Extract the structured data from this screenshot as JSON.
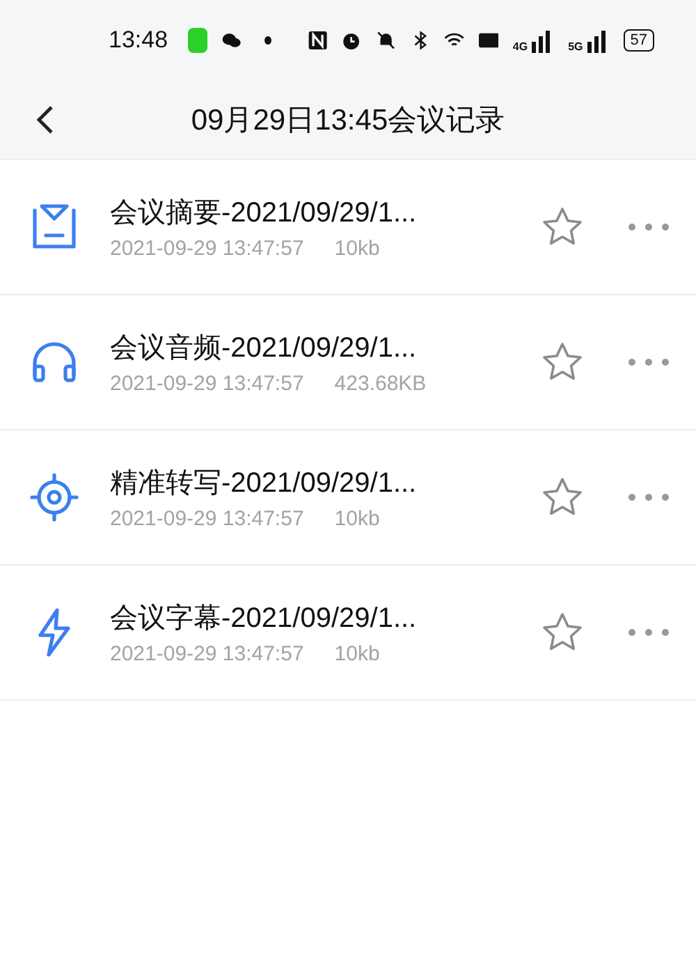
{
  "status_bar": {
    "time": "13:48",
    "network_labels": [
      "4G",
      "5G"
    ],
    "battery": "57"
  },
  "header": {
    "title": "09月29日13:45会议记录"
  },
  "files": [
    {
      "kind": "summary",
      "title": "会议摘要-2021/09/29/1...",
      "time": "2021-09-29 13:47:57",
      "size": "10kb"
    },
    {
      "kind": "audio",
      "title": "会议音频-2021/09/29/1...",
      "time": "2021-09-29 13:47:57",
      "size": "423.68KB"
    },
    {
      "kind": "transcript",
      "title": "精准转写-2021/09/29/1...",
      "time": "2021-09-29 13:47:57",
      "size": "10kb"
    },
    {
      "kind": "subtitle",
      "title": "会议字幕-2021/09/29/1...",
      "time": "2021-09-29 13:47:57",
      "size": "10kb"
    }
  ]
}
